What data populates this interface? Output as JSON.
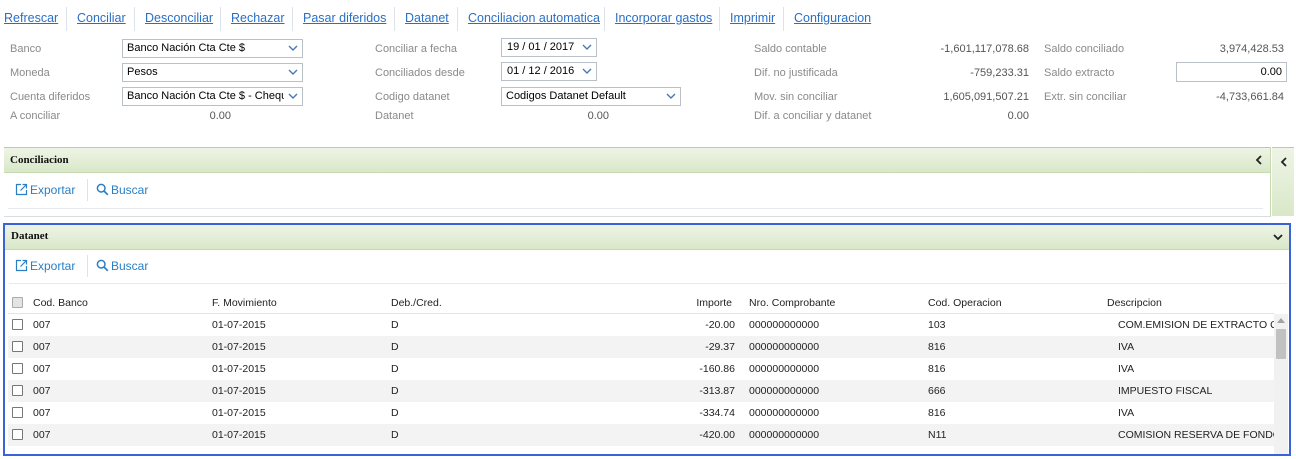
{
  "toolbar": {
    "refrescar": "Refrescar",
    "conciliar": "Conciliar",
    "desconciliar": "Desconciliar",
    "rechazar": "Rechazar",
    "pasar_diferidos": "Pasar diferidos",
    "datanet": "Datanet",
    "conciliacion_automatica": "Conciliacion automatica",
    "incorporar_gastos": "Incorporar gastos",
    "imprimir": "Imprimir",
    "configuracion": "Configuracion"
  },
  "form": {
    "banco_label": "Banco",
    "banco_value": "Banco Nación Cta Cte $",
    "moneda_label": "Moneda",
    "moneda_value": "Pesos",
    "cuenta_diferidos_label": "Cuenta diferidos",
    "cuenta_diferidos_value": "Banco Nación Cta Cte $ - Cheques Diferidos",
    "a_conciliar_label": "A conciliar",
    "a_conciliar_value": "0.00",
    "conciliar_fecha_label": "Conciliar a fecha",
    "conciliar_fecha_value": "19 / 01 /  2017",
    "conciliados_desde_label": "Conciliados desde",
    "conciliados_desde_value": "01 / 12 /  2016",
    "codigo_datanet_label": "Codigo datanet",
    "codigo_datanet_value": "Codigos Datanet Default",
    "datanet_label": "Datanet",
    "datanet_value": "0.00",
    "saldo_contable_label": "Saldo contable",
    "saldo_contable_value": "-1,601,117,078.68",
    "dif_no_justificada_label": "Dif. no justificada",
    "dif_no_justificada_value": "-759,233.31",
    "mov_sin_conciliar_label": "Mov. sin conciliar",
    "mov_sin_conciliar_value": "1,605,091,507.21",
    "dif_a_conciliar_label": "Dif. a conciliar y datanet",
    "dif_a_conciliar_value": "0.00",
    "saldo_conciliado_label": "Saldo conciliado",
    "saldo_conciliado_value": "3,974,428.53",
    "saldo_extracto_label": "Saldo extracto",
    "saldo_extracto_value": "0.00",
    "extr_sin_conciliar_label": "Extr. sin conciliar",
    "extr_sin_conciliar_value": "-4,733,661.84"
  },
  "conciliacion_panel": {
    "title": "Conciliacion",
    "exportar": "Exportar",
    "buscar": "Buscar"
  },
  "datanet_panel": {
    "title": "Datanet",
    "exportar": "Exportar",
    "buscar": "Buscar",
    "columns": [
      "Cod. Banco",
      "F. Movimiento",
      "Deb./Cred.",
      "Importe",
      "Nro. Comprobante",
      "Cod. Operacion",
      "Descripcion"
    ],
    "rows": [
      [
        "007",
        "01-07-2015",
        "D",
        "-20.00",
        "000000000000",
        "103",
        "COM.EMISION DE EXTRACTO Q"
      ],
      [
        "007",
        "01-07-2015",
        "D",
        "-29.37",
        "000000000000",
        "816",
        "IVA"
      ],
      [
        "007",
        "01-07-2015",
        "D",
        "-160.86",
        "000000000000",
        "816",
        "IVA"
      ],
      [
        "007",
        "01-07-2015",
        "D",
        "-313.87",
        "000000000000",
        "666",
        "IMPUESTO FISCAL"
      ],
      [
        "007",
        "01-07-2015",
        "D",
        "-334.74",
        "000000000000",
        "816",
        "IVA"
      ],
      [
        "007",
        "01-07-2015",
        "D",
        "-420.00",
        "000000000000",
        "N11",
        "COMISION RESERVA DE FONDO"
      ]
    ]
  },
  "colors": {
    "link": "#2a6fc4",
    "panel_header": "#dce9cc",
    "focus_border": "#3a63d8"
  }
}
